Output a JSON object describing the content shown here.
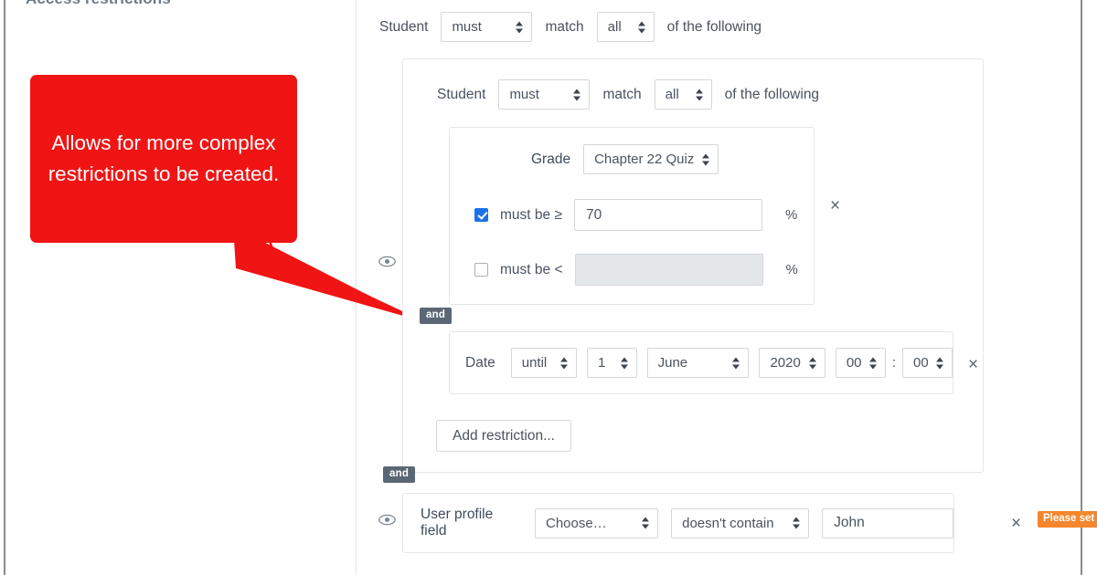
{
  "page": {
    "section_heading": "Access restrictions"
  },
  "callout": {
    "text": "Allows for more complex restrictions to be created.",
    "color": "#f01414",
    "text_color": "#ffffff"
  },
  "header_row": {
    "subject_label": "Student",
    "must_select": "must",
    "match_label": "match",
    "quantifier_select": "all",
    "suffix_label": "of the following"
  },
  "group": {
    "header_row": {
      "subject_label": "Student",
      "must_select": "must",
      "match_label": "match",
      "quantifier_select": "all",
      "suffix_label": "of the following"
    },
    "grade_restriction": {
      "label": "Grade",
      "item_select": "Chapter 22 Quiz",
      "min_condition": {
        "checked": true,
        "label": "must be ≥",
        "value": "70",
        "unit": "%"
      },
      "max_condition": {
        "checked": false,
        "label": "must be <",
        "value": "",
        "unit": "%",
        "disabled": true
      },
      "remove_label": "×"
    },
    "operator_badge_1": "and",
    "date_restriction": {
      "label": "Date",
      "direction_select": "until",
      "day_select": "1",
      "month_select": "June",
      "year_select": "2020",
      "hour_select": "00",
      "separator": ":",
      "minute_select": "00",
      "remove_label": "×"
    },
    "add_restriction_button": "Add restriction..."
  },
  "operator_badge_2": "and",
  "profile_restriction": {
    "label": "User profile field",
    "field_select": "Choose…",
    "operator_select": "doesn't contain",
    "value_input": "John",
    "remove_label": "×",
    "status_badge": "Please set",
    "status_badge_color": "#f4862d"
  },
  "icons": {
    "eye_visibility_1": "eye-icon",
    "eye_visibility_2": "eye-icon"
  }
}
